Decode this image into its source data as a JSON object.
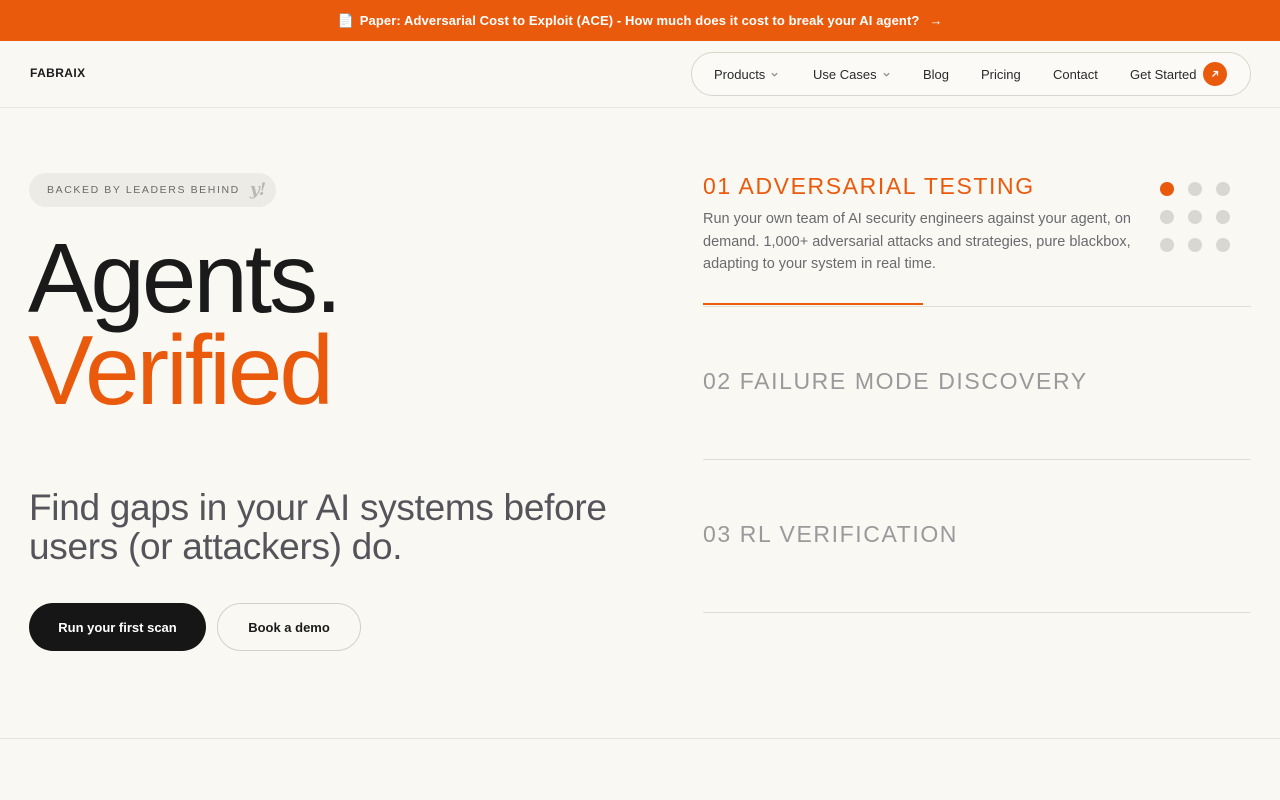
{
  "announcement": {
    "text": "Paper: Adversarial Cost to Exploit (ACE) - How much does it cost to break your AI agent?",
    "arrow": "→",
    "icon": "document-icon"
  },
  "header": {
    "logo": "FABRAIX",
    "nav": [
      {
        "label": "Products",
        "dropdown": true
      },
      {
        "label": "Use Cases",
        "dropdown": true
      },
      {
        "label": "Blog"
      },
      {
        "label": "Pricing"
      },
      {
        "label": "Contact"
      },
      {
        "label": "Get Started",
        "icon": "arrow-up-right-icon"
      }
    ]
  },
  "hero": {
    "backed_label": "BACKED BY LEADERS BEHIND",
    "backed_logo": "y!",
    "headline_line1": "Agents.",
    "headline_line2": "Verified",
    "subheadline": "Find gaps in your AI systems before users (or attackers) do.",
    "primary_cta": "Run your first scan",
    "secondary_cta": "Book a demo"
  },
  "features": [
    {
      "title": "01 ADVERSARIAL TESTING",
      "active": true,
      "description": "Run your own team of AI security engineers against your agent, on demand. 1,000+ adversarial attacks and strategies, pure blackbox, adapting to your system in real time."
    },
    {
      "title": "02 FAILURE MODE DISCOVERY",
      "active": false
    },
    {
      "title": "03 RL VERIFICATION",
      "active": false
    }
  ],
  "dot_grid": {
    "active_index": 0,
    "total": 9
  },
  "colors": {
    "accent": "#ea5a0c",
    "background": "#f9f8f3",
    "dark": "#161616",
    "muted": "#9a999c"
  }
}
